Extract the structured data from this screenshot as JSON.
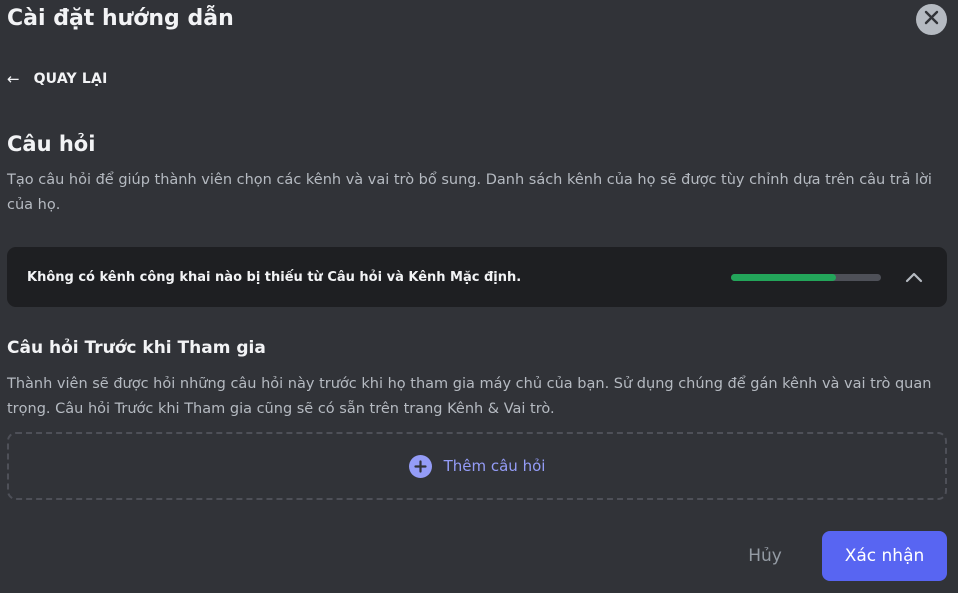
{
  "header": {
    "title": "Cài đặt hướng dẫn",
    "close_icon": "close-icon"
  },
  "back": {
    "arrow": "←",
    "label": "QUAY LẠI"
  },
  "section": {
    "title": "Câu hỏi",
    "description": "Tạo câu hỏi để giúp thành viên chọn các kênh và vai trò bổ sung. Danh sách kênh của họ sẽ được tùy chỉnh dựa trên câu trả lời của họ."
  },
  "status": {
    "message": "Không có kênh công khai nào bị thiếu từ Câu hỏi và Kênh Mặc định.",
    "progress_fraction": 0.7,
    "progress_color": "#23a55a",
    "toggle_icon": "chevron-up-icon"
  },
  "pre_join": {
    "title": "Câu hỏi Trước khi Tham gia",
    "description": "Thành viên sẽ được hỏi những câu hỏi này trước khi họ tham gia máy chủ của bạn. Sử dụng chúng để gán kênh và vai trò quan trọng. Câu hỏi Trước khi Tham gia cũng sẽ có sẵn trên trang Kênh & Vai trò.",
    "add_label": "Thêm câu hỏi",
    "add_icon": "plus-circle-icon"
  },
  "footer": {
    "cancel_label": "Hủy",
    "confirm_label": "Xác nhận",
    "confirm_color": "#5865f2"
  }
}
